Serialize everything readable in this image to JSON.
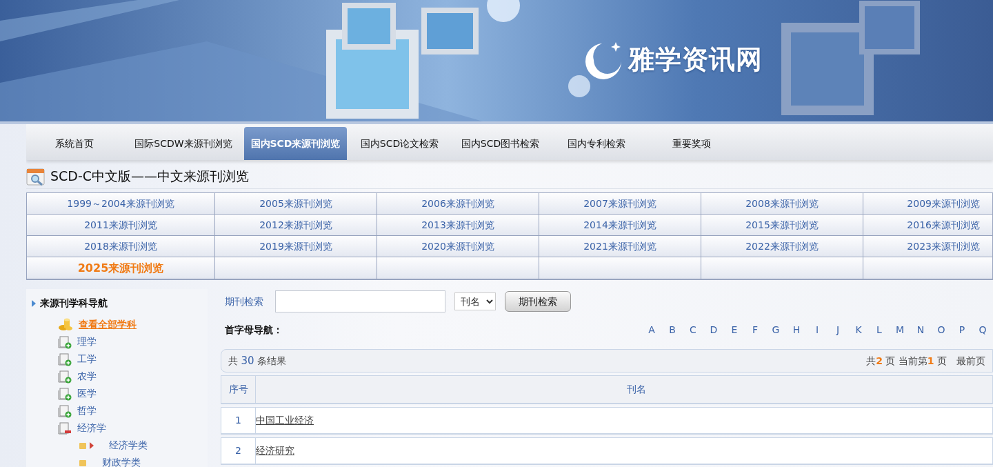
{
  "banner": {
    "logo_text": "雅学资讯网"
  },
  "nav": [
    {
      "label": "系统首页",
      "selected": false
    },
    {
      "label": "国际SCDW来源刊浏览",
      "selected": false
    },
    {
      "label": "国内SCD来源刊浏览",
      "selected": true
    },
    {
      "label": "国内SCD论文检索",
      "selected": false
    },
    {
      "label": "国内SCD图书检索",
      "selected": false
    },
    {
      "label": "国内专利检索",
      "selected": false
    },
    {
      "label": "重要奖项",
      "selected": false
    }
  ],
  "page_title": "SCD-C中文版——中文来源刊浏览",
  "years": [
    {
      "label": "1999～2004来源刊浏览",
      "highlighted": false
    },
    {
      "label": "2005来源刊浏览",
      "highlighted": false
    },
    {
      "label": "2006来源刊浏览",
      "highlighted": false
    },
    {
      "label": "2007来源刊浏览",
      "highlighted": false
    },
    {
      "label": "2008来源刊浏览",
      "highlighted": false
    },
    {
      "label": "2009来源刊浏览",
      "highlighted": false
    },
    {
      "label": "2011来源刊浏览",
      "highlighted": false
    },
    {
      "label": "2012来源刊浏览",
      "highlighted": false
    },
    {
      "label": "2013来源刊浏览",
      "highlighted": false
    },
    {
      "label": "2014来源刊浏览",
      "highlighted": false
    },
    {
      "label": "2015来源刊浏览",
      "highlighted": false
    },
    {
      "label": "2016来源刊浏览",
      "highlighted": false
    },
    {
      "label": "2018来源刊浏览",
      "highlighted": false
    },
    {
      "label": "2019来源刊浏览",
      "highlighted": false
    },
    {
      "label": "2020来源刊浏览",
      "highlighted": false
    },
    {
      "label": "2021来源刊浏览",
      "highlighted": false
    },
    {
      "label": "2022来源刊浏览",
      "highlighted": false
    },
    {
      "label": "2023来源刊浏览",
      "highlighted": false
    },
    {
      "label": "2025来源刊浏览",
      "highlighted": true
    }
  ],
  "sidebar": {
    "heading": "来源刊学科导航",
    "items": [
      {
        "kind": "all",
        "label": "查看全部学科"
      },
      {
        "kind": "subject",
        "label": "理学",
        "expanded": false
      },
      {
        "kind": "subject",
        "label": "工学",
        "expanded": false
      },
      {
        "kind": "subject",
        "label": "农学",
        "expanded": false
      },
      {
        "kind": "subject",
        "label": "医学",
        "expanded": false
      },
      {
        "kind": "subject",
        "label": "哲学",
        "expanded": false
      },
      {
        "kind": "subject",
        "label": "经济学",
        "expanded": true,
        "children": [
          {
            "label": "经济学类",
            "selected": true
          },
          {
            "label": "财政学类",
            "selected": false
          }
        ]
      }
    ]
  },
  "search": {
    "label": "期刊检索",
    "select": "刊名",
    "button": "期刊检索"
  },
  "letter_nav": {
    "label": "首字母导航：",
    "letters": [
      "A",
      "B",
      "C",
      "D",
      "E",
      "F",
      "G",
      "H",
      "I",
      "J",
      "K",
      "L",
      "M",
      "N",
      "O",
      "P",
      "Q"
    ]
  },
  "results": {
    "prefix": "共",
    "count": "30",
    "suffix": "条结果",
    "pages_prefix": "共",
    "pages_total": "2",
    "pages_mid": "页 当前第",
    "pages_current": "1",
    "pages_suffix": "页",
    "first_page": "最前页"
  },
  "table": {
    "columns": [
      "序号",
      "刊名"
    ],
    "rows": [
      {
        "index": "1",
        "name": "中国工业经济"
      },
      {
        "index": "2",
        "name": "经济研究"
      }
    ]
  }
}
